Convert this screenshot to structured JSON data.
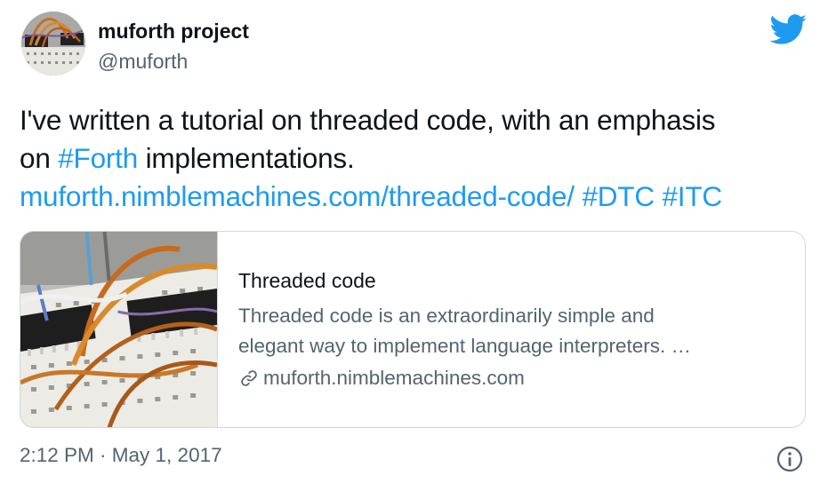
{
  "author": {
    "display_name": "muforth project",
    "handle": "@muforth",
    "avatar_icon": "breadboard-photo"
  },
  "brand": {
    "logo_icon": "twitter-bird-icon",
    "accent_color": "#1d9bf0"
  },
  "tweet": {
    "text_line1": "I've written a tutorial on threaded code, with an emphasis",
    "text_line2_prefix": "on ",
    "hashtag_forth": "#Forth",
    "text_line2_suffix": " implementations.",
    "link_url": "muforth.nimblemachines.com/threaded-code/",
    "hashtag_dtc": "#DTC",
    "hashtag_itc": "#ITC"
  },
  "card": {
    "title": "Threaded code",
    "description_line1": "Threaded code is an extraordinarily simple and",
    "description_line2": "elegant way to implement language interpreters. …",
    "domain": "muforth.nimblemachines.com",
    "domain_icon": "link-icon",
    "image": "breadboard-photo"
  },
  "footer": {
    "timestamp": "2:12 PM · May 1, 2017",
    "info_icon": "info-icon"
  }
}
